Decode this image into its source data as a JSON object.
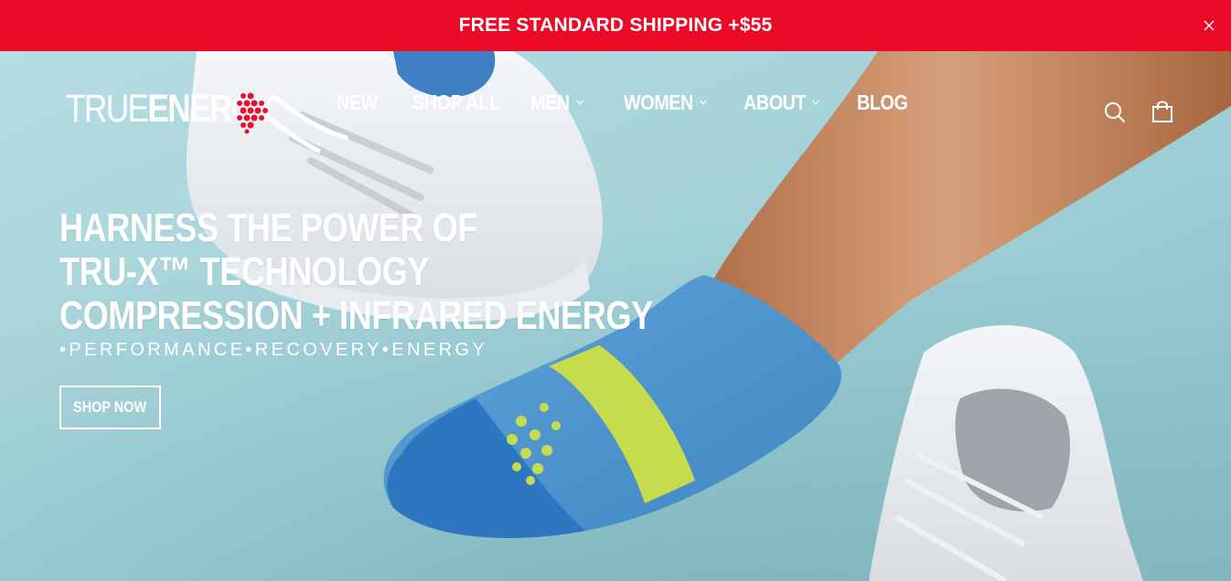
{
  "announcement": {
    "text": "FREE STANDARD SHIPPING +$55",
    "background": "#ec0928"
  },
  "header": {
    "logo": {
      "part1": "TRUE",
      "part2": "ENERGY",
      "mark_color": "#e8112d"
    },
    "nav": [
      {
        "label": "NEW",
        "has_dropdown": false
      },
      {
        "label": "SHOP ALL",
        "has_dropdown": false
      },
      {
        "label": "MEN",
        "has_dropdown": true
      },
      {
        "label": "WOMEN",
        "has_dropdown": true
      },
      {
        "label": "ABOUT",
        "has_dropdown": true
      },
      {
        "label": "BLOG",
        "has_dropdown": false
      }
    ],
    "icons": [
      "search-icon",
      "cart-icon"
    ]
  },
  "hero": {
    "headline": [
      "HARNESS THE POWER OF",
      "TRU-X™ TECHNOLOGY",
      "COMPRESSION + INFRARED ENERGY"
    ],
    "tagline": "•PERFORMANCE•RECOVERY•ENERGY",
    "cta": "SHOP NOW"
  }
}
